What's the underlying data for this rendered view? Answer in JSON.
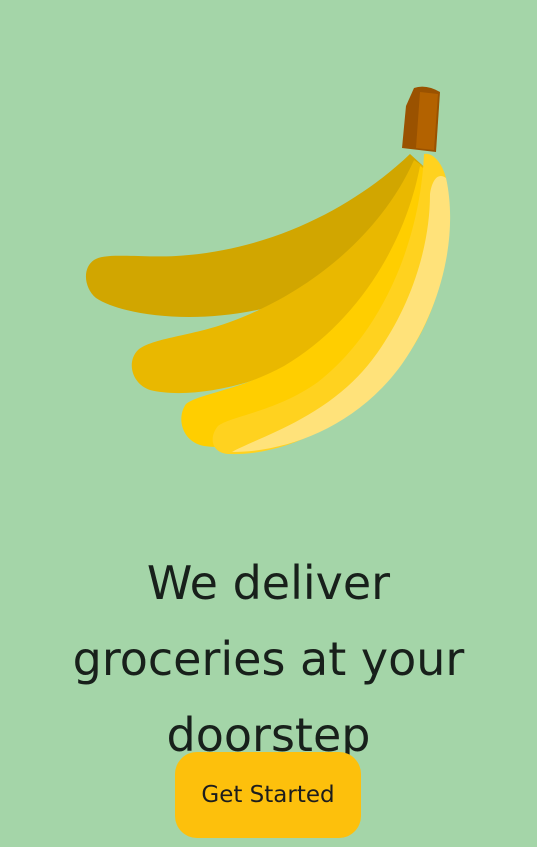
{
  "colors": {
    "background": "#a4d5a8",
    "heading_text": "#18201b",
    "cta_background": "#fdc00c",
    "cta_text": "#1d1d1d"
  },
  "illustration": {
    "icon": "banana-bunch-icon"
  },
  "headline": {
    "line1": "We deliver",
    "line2": "groceries at your",
    "line3": "doorstep"
  },
  "cta": {
    "label": "Get Started"
  }
}
